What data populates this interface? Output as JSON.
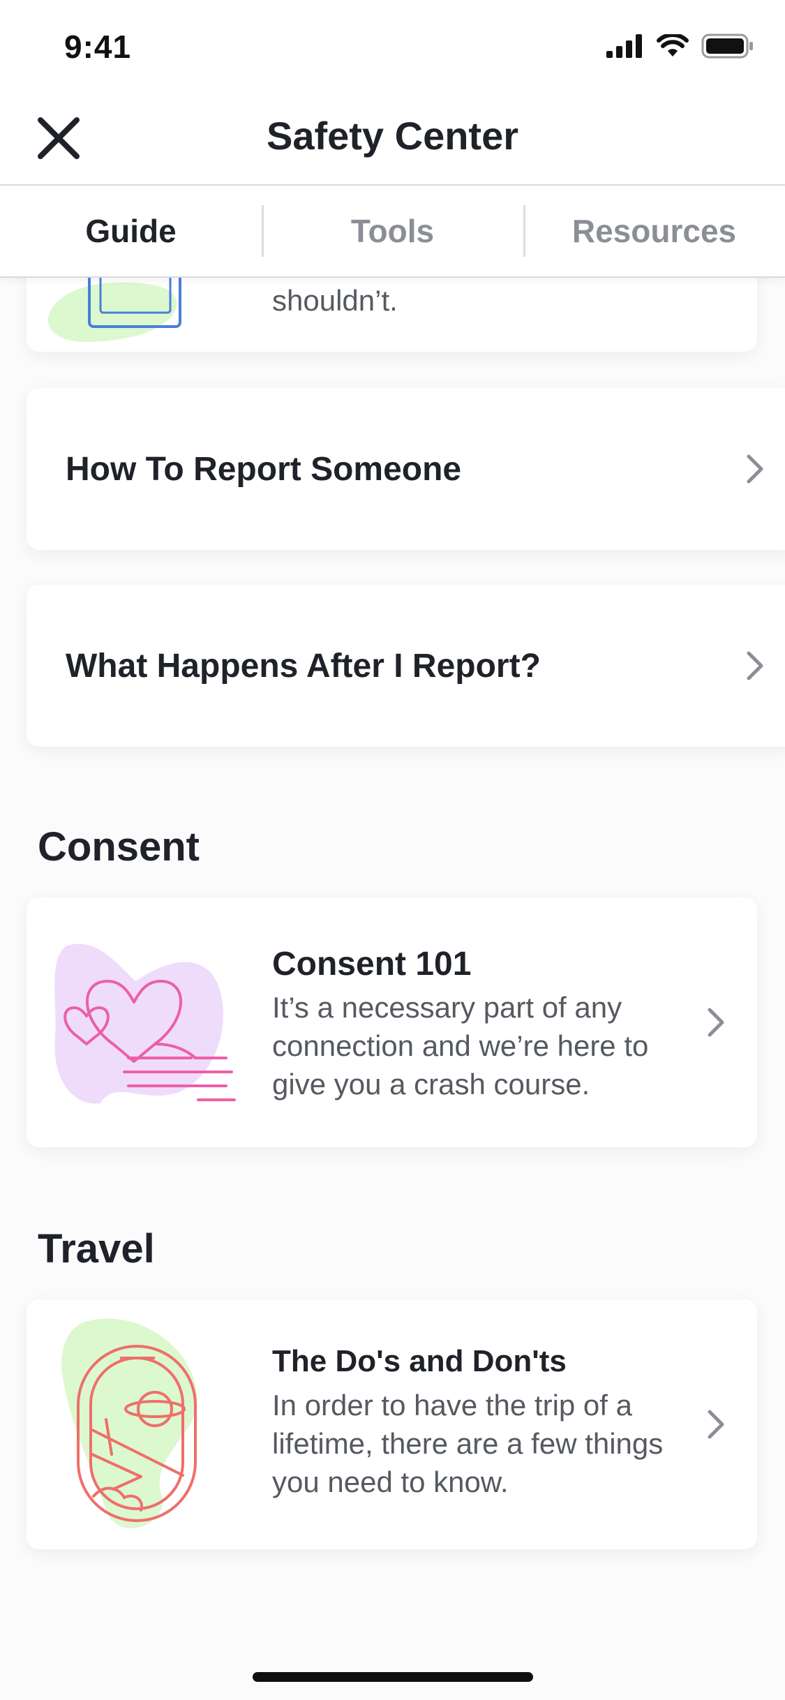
{
  "status_bar": {
    "time": "9:41"
  },
  "nav": {
    "title": "Safety Center"
  },
  "tabs": [
    {
      "label": "Guide",
      "active": true
    },
    {
      "label": "Tools",
      "active": false
    },
    {
      "label": "Resources",
      "active": false
    }
  ],
  "partial_card": {
    "desc_tail": "shouldn’t."
  },
  "cards": {
    "report": {
      "title": "How To Report Someone"
    },
    "after_report": {
      "title": "What Happens After I Report?"
    }
  },
  "sections": {
    "consent": {
      "heading": "Consent",
      "card": {
        "title": "Consent 101",
        "description": "It’s a necessary part of any connection and we’re here to give you a crash course.",
        "icon": "hearts-hand-icon"
      }
    },
    "travel": {
      "heading": "Travel",
      "card": {
        "title": "The Do's and Don'ts",
        "description": "In order to have the trip of a lifetime, there are a few things you need to know.",
        "icon": "airplane-window-icon"
      }
    }
  },
  "colors": {
    "text_primary": "#1f2229",
    "text_secondary": "#555960",
    "tab_inactive": "#8b8e95",
    "illus_blue": "#4a7fd8",
    "illus_pink": "#ec5fa8",
    "illus_coral": "#ee6f6a",
    "blob_green": "#dcf8cf",
    "blob_lavender": "#efdcfb"
  }
}
